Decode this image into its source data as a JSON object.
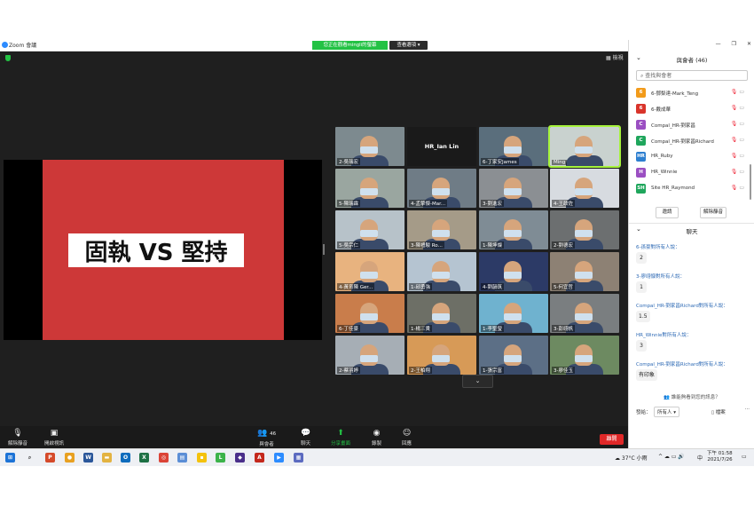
{
  "window": {
    "app_title": "Zoom 會議",
    "viewing_banner": "您正在觀看mingli的螢幕",
    "view_options": "查看選項 ▾",
    "gallery_view": "▦ 檢視"
  },
  "shared_screen": {
    "text": "固執 VS 堅持"
  },
  "tiles": [
    {
      "label": "2-吳瑞宏",
      "row": 0,
      "col": 0,
      "bg": "#7d8a8f",
      "type": "video"
    },
    {
      "label": "HR_Ian Lin",
      "row": 0,
      "col": 1,
      "bg": "#1a1a1a",
      "type": "name"
    },
    {
      "label": "6-丁家安James",
      "row": 0,
      "col": 2,
      "bg": "#5a6e7c",
      "type": "video"
    },
    {
      "label": "Ming",
      "row": 0,
      "col": 3,
      "bg": "#c9d2cf",
      "type": "video",
      "active": true
    },
    {
      "label": "5-陳瑞霖",
      "row": 1,
      "col": 0,
      "bg": "#9aa6a0",
      "type": "video"
    },
    {
      "label": "4-孟擎傑-Mar...",
      "row": 1,
      "col": 1,
      "bg": "#6f7c86",
      "type": "video"
    },
    {
      "label": "3-劉進宏",
      "row": 1,
      "col": 2,
      "bg": "#8b8f93",
      "type": "video"
    },
    {
      "label": "4-王政佐",
      "row": 1,
      "col": 3,
      "bg": "#d7dbe0",
      "type": "video"
    },
    {
      "label": "5-吳宗仁",
      "row": 2,
      "col": 0,
      "bg": "#b7c2c9",
      "type": "video"
    },
    {
      "label": "3-陳禮駿 Ro...",
      "row": 2,
      "col": 1,
      "bg": "#a59b88",
      "type": "video"
    },
    {
      "label": "1-陳坤燦",
      "row": 2,
      "col": 2,
      "bg": "#7f8c95",
      "type": "video"
    },
    {
      "label": "2-劉德宏",
      "row": 2,
      "col": 3,
      "bg": "#6c6f70",
      "type": "video"
    },
    {
      "label": "4-黃育陳 Ger...",
      "row": 3,
      "col": 0,
      "bg": "#e8b37f",
      "type": "video"
    },
    {
      "label": "1-邱勇強",
      "row": 3,
      "col": 1,
      "bg": "#b5c4d1",
      "type": "video"
    },
    {
      "label": "4-劉韻筑",
      "row": 3,
      "col": 2,
      "bg": "#2c3a66",
      "type": "video"
    },
    {
      "label": "5-何宜哲",
      "row": 3,
      "col": 3,
      "bg": "#8d8174",
      "type": "video"
    },
    {
      "label": "6-丁佳豪",
      "row": 4,
      "col": 0,
      "bg": "#c97d4b",
      "type": "video"
    },
    {
      "label": "1-楊三貴",
      "row": 4,
      "col": 1,
      "bg": "#6d6f66",
      "type": "video"
    },
    {
      "label": "1-李聖瑩",
      "row": 4,
      "col": 2,
      "bg": "#6fb2cf",
      "type": "video"
    },
    {
      "label": "3-彭翊帆",
      "row": 4,
      "col": 3,
      "bg": "#7a7e80",
      "type": "video"
    },
    {
      "label": "2-蔡羽婷",
      "row": 5,
      "col": 0,
      "bg": "#a6aeb5",
      "type": "video"
    },
    {
      "label": "2-王柏翔",
      "row": 5,
      "col": 1,
      "bg": "#d79a57",
      "type": "video"
    },
    {
      "label": "1-張宗富",
      "row": 5,
      "col": 2,
      "bg": "#5c6f86",
      "type": "video"
    },
    {
      "label": "3-廖佳玉",
      "row": 5,
      "col": 3,
      "bg": "#6d8a61",
      "type": "video"
    }
  ],
  "toolbar": {
    "unmute": "解除靜音",
    "start_video": "開啟視訊",
    "participants": "與會者",
    "participants_count": "46",
    "chat": "聊天",
    "share_screen": "分享畫面",
    "record": "錄製",
    "reactions": "回應",
    "end": "離開"
  },
  "panel": {
    "title": "與會者 (46)",
    "search_placeholder": "查找與會者",
    "participants": [
      {
        "initial": "6",
        "name": "6-鄧梨達-Mark_Teng",
        "color": "#f29b1b"
      },
      {
        "initial": "6",
        "name": "6-戴成華",
        "color": "#d9342b"
      },
      {
        "initial": "C",
        "name": "Compal_HR-劉家昌",
        "color": "#9b4fc2"
      },
      {
        "initial": "C",
        "name": "Compal_HR-劉家昌Richard",
        "color": "#1fa65c"
      },
      {
        "initial": "HR",
        "name": "HR_Ruby",
        "color": "#2d7fd0"
      },
      {
        "initial": "H",
        "name": "HR_Winnie",
        "color": "#9b4fc2"
      },
      {
        "initial": "SH",
        "name": "Site HR_Raymond",
        "color": "#1fa65c"
      }
    ],
    "invite_btn": "邀請",
    "unmute_all_btn": "解除靜音",
    "chat_title": "聊天",
    "messages": [
      {
        "from": "6-孫豪對所有人說：",
        "text": "2"
      },
      {
        "from": "3-廖翊慷對所有人說：",
        "text": "1"
      },
      {
        "from": "Compal_HR-劉家昌Richard對所有人說：",
        "text": "1.5"
      },
      {
        "from": "HR_Winnie對所有人說：",
        "text": "3"
      },
      {
        "from": "Compal_HR-劉家昌Richard對所有人說：",
        "text": "有印象"
      }
    ],
    "privacy": "誰能夠看到您的訊息？",
    "send_to_label": "發給：",
    "send_to_value": "所有人 ▾",
    "file_label": "檔案",
    "more": "···"
  },
  "taskbar": {
    "weather": "37°C 小雨",
    "ime": "中",
    "time": "下午 01:58",
    "date": "2021/7/26"
  }
}
